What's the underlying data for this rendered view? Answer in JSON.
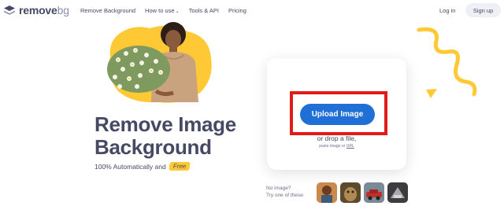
{
  "brand": {
    "name_main": "remove",
    "name_suffix": "bg"
  },
  "nav": {
    "links": [
      "Remove Background",
      "How to use",
      "Tools & API",
      "Pricing"
    ],
    "login": "Log in",
    "signup": "Sign up"
  },
  "hero": {
    "title_line1": "Remove Image",
    "title_line2": "Background",
    "subtitle": "100% Automatically and",
    "badge": "Free"
  },
  "upload": {
    "button": "Upload Image",
    "drop_text": "or drop a file,",
    "paste_prefix": "paste image or",
    "paste_link": "URL"
  },
  "samples": {
    "line1": "No image?",
    "line2": "Try one of these:",
    "items": [
      "sample-person",
      "sample-animal",
      "sample-car",
      "sample-product"
    ]
  },
  "colors": {
    "accent": "#1f6fd6",
    "text": "#454964",
    "yellow": "#ffc936",
    "highlight": "#e11a1a"
  }
}
